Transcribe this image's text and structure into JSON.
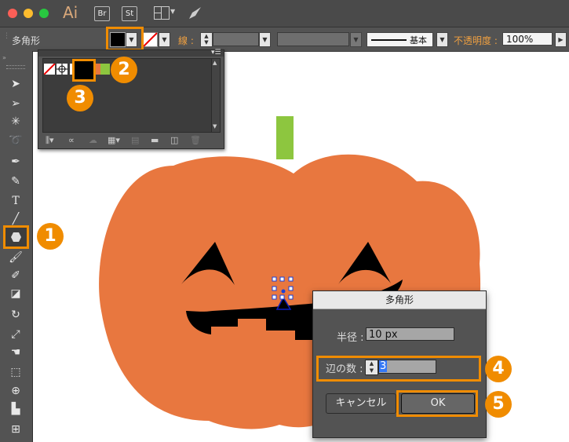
{
  "app": {
    "name": "Ai",
    "buttons": [
      "Br",
      "St"
    ]
  },
  "control_bar": {
    "tool_name": "多角形",
    "stroke_label": "線 :",
    "stroke_style": "基本",
    "opacity_label": "不透明度 :",
    "opacity_value": "100%"
  },
  "dialog": {
    "title": "多角形",
    "radius_label": "半径 :",
    "radius_value": "10 px",
    "sides_label": "辺の数 :",
    "sides_value": "3",
    "cancel_label": "キャンセル",
    "ok_label": "OK"
  },
  "callouts": [
    "1",
    "2",
    "3",
    "4",
    "5"
  ],
  "colors": {
    "pumpkin": "#e8773f",
    "stem": "#8dc63f",
    "face": "#000000",
    "highlight": "#f08c00",
    "ui_dark": "#535353"
  },
  "tools": [
    "selection-tool",
    "direct-selection-tool",
    "magic-wand-tool",
    "lasso-tool",
    "pen-tool",
    "curvature-tool",
    "type-tool",
    "line-tool",
    "polygon-tool",
    "paintbrush-tool",
    "blob-brush-tool",
    "eraser-tool",
    "rotate-tool",
    "scale-tool",
    "warp-tool",
    "free-transform-tool",
    "shape-builder-tool",
    "column-graph-tool",
    "artboard-tool"
  ]
}
